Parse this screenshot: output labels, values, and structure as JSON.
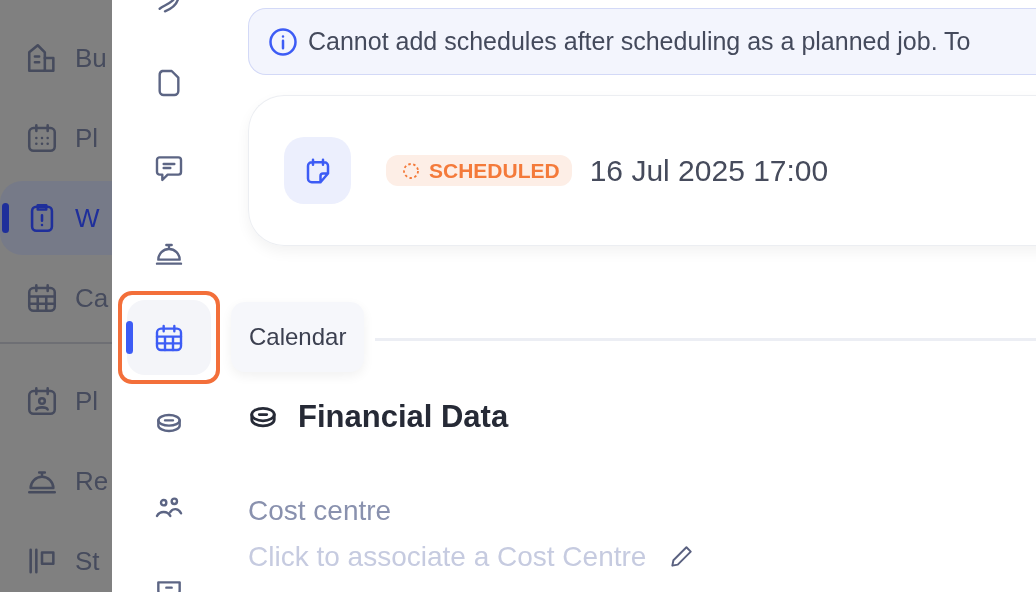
{
  "backdrop_sidebar": {
    "sections": [
      [
        {
          "label": "Bu",
          "selected": false
        },
        {
          "label": "Pl",
          "selected": false
        },
        {
          "label": "W",
          "selected": true
        },
        {
          "label": "Ca",
          "selected": false
        }
      ],
      [
        {
          "label": "Pl",
          "selected": false
        },
        {
          "label": "Re",
          "selected": false
        },
        {
          "label": "St",
          "selected": false
        }
      ]
    ]
  },
  "rail": {
    "items": [
      {
        "selected": false
      },
      {
        "selected": false
      },
      {
        "selected": false
      },
      {
        "selected": false
      },
      {
        "selected": true
      },
      {
        "selected": false
      },
      {
        "selected": false
      },
      {
        "selected": false
      }
    ],
    "tooltip": "Calendar"
  },
  "notice": {
    "text": "Cannot add schedules after scheduling as a planned job. To"
  },
  "schedule_card": {
    "status": "SCHEDULED",
    "datetime": "16 Jul 2025 17:00"
  },
  "financial": {
    "title": "Financial Data",
    "fields": [
      {
        "label": "Cost centre",
        "placeholder": "Click to associate a Cost Centre"
      }
    ]
  }
}
